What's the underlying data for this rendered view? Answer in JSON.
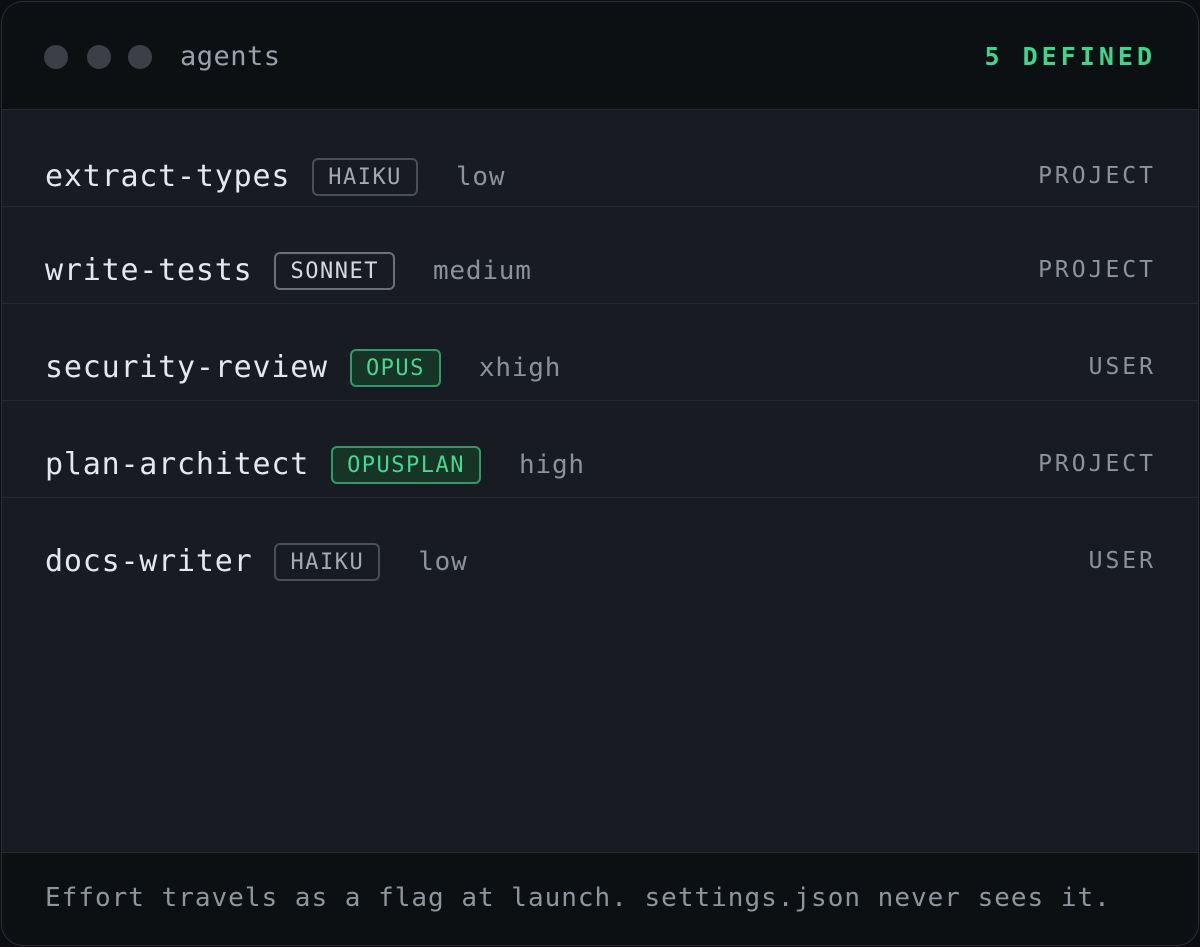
{
  "window": {
    "title": "agents",
    "count_label": "5 DEFINED"
  },
  "agents": [
    {
      "name": "extract-types",
      "model": "HAIKU",
      "effort": "low",
      "scope": "PROJECT"
    },
    {
      "name": "write-tests",
      "model": "SONNET",
      "effort": "medium",
      "scope": "PROJECT"
    },
    {
      "name": "security-review",
      "model": "OPUS",
      "effort": "xhigh",
      "scope": "USER"
    },
    {
      "name": "plan-architect",
      "model": "OPUSPLAN",
      "effort": "high",
      "scope": "PROJECT"
    },
    {
      "name": "docs-writer",
      "model": "HAIKU",
      "effort": "low",
      "scope": "USER"
    }
  ],
  "footer": {
    "note": "Effort travels as a flag at launch. settings.json never sees it."
  },
  "colors": {
    "accent": "#3dd68c",
    "background": "#181c22",
    "titlebar": "#0d1013"
  }
}
